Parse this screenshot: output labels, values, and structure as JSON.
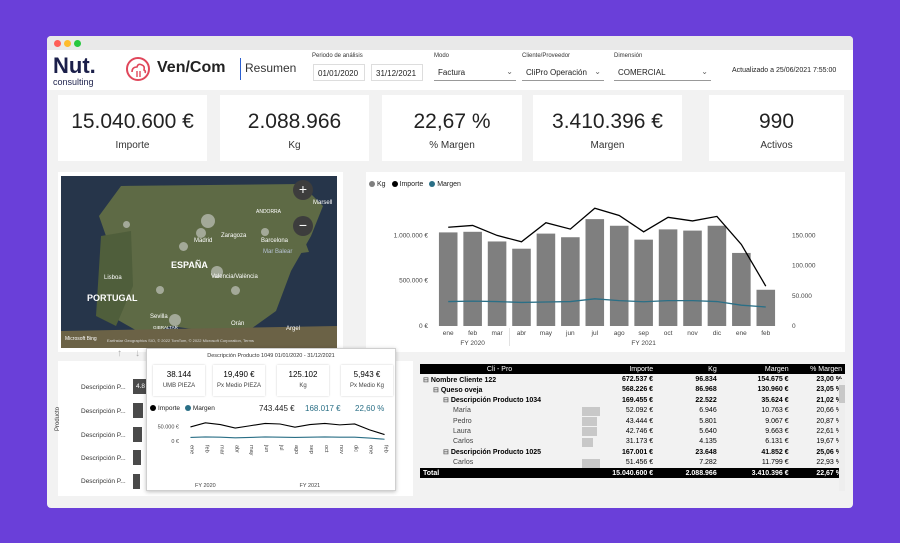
{
  "header": {
    "brand": "Nut.",
    "brand_sub": "consulting",
    "app_title": "Ven/Com",
    "page_title": "Resumen",
    "updated": "Actualizado a 25/06/2021 7:55:00"
  },
  "filters": {
    "periodo_label": "Periodo de análisis",
    "date_from": "01/01/2020",
    "date_to": "31/12/2021",
    "modo_label": "Modo",
    "modo_value": "Factura",
    "cliente_label": "Cliente/Proveedor",
    "cliente_value": "CliPro Operación",
    "dimension_label": "Dimensión",
    "dimension_value": "COMERCIAL"
  },
  "kpis": [
    {
      "value": "15.040.600 €",
      "label": "Importe"
    },
    {
      "value": "2.088.966",
      "label": "Kg"
    },
    {
      "value": "22,67 %",
      "label": "% Margen"
    },
    {
      "value": "3.410.396 €",
      "label": "Margen"
    },
    {
      "value": "990",
      "label": "Activos"
    }
  ],
  "map": {
    "labels": {
      "espana": "ESPAÑA",
      "portugal": "PORTUGAL",
      "madrid": "Madrid",
      "zaragoza": "Zaragoza",
      "barcelona": "Barcelona",
      "andorra": "ANDORRA",
      "marsella": "Marsell",
      "lisboa": "Lisboa",
      "valencia": "Valencia/València",
      "mar_balear": "Mar Balear",
      "sevilla": "Sevilla",
      "gibraltar": "GIBRALTAR",
      "oran": "Orán",
      "argel": "Argel",
      "bing": "Microsoft Bing",
      "attribution": "Earthstar Geographics SIO, © 2022 TomTom, © 2022 Microsoft Corporation, Terms",
      "zoom_in": "+",
      "zoom_out": "−"
    }
  },
  "chart_data": {
    "type": "bar",
    "legend": [
      "Kg",
      "Importe",
      "Margen"
    ],
    "categories": [
      "ene",
      "feb",
      "mar",
      "abr",
      "may",
      "jun",
      "jul",
      "ago",
      "sep",
      "oct",
      "nov",
      "dic",
      "ene",
      "feb"
    ],
    "year_groups": [
      {
        "label": "FY 2020",
        "span": [
          0,
          2
        ]
      },
      {
        "label": "FY 2021",
        "span": [
          3,
          13
        ]
      }
    ],
    "series": [
      {
        "name": "Kg",
        "axis": "right",
        "values": [
          155000,
          156000,
          140000,
          128000,
          153000,
          147000,
          177000,
          166000,
          143000,
          160000,
          158000,
          166000,
          121000,
          60000
        ]
      },
      {
        "name": "Importe",
        "axis": "left",
        "values": [
          1090000,
          1110000,
          1000000,
          930000,
          1140000,
          1070000,
          1300000,
          1220000,
          1040000,
          1200000,
          1160000,
          1210000,
          900000,
          440000
        ]
      },
      {
        "name": "Margen",
        "axis": "left",
        "values": [
          270000,
          275000,
          270000,
          260000,
          265000,
          270000,
          300000,
          280000,
          268000,
          280000,
          280000,
          270000,
          230000,
          210000
        ]
      }
    ],
    "left_ticks": [
      "1.000.000 €",
      "500.000 €",
      "0 €"
    ],
    "right_ticks": [
      "150.000",
      "100.000",
      "50.000",
      "0"
    ],
    "ylim_left": [
      0,
      1380000
    ],
    "ylim_right": [
      0,
      207000
    ],
    "colors": {
      "Kg": "#7f7f7f",
      "Importe": "#000000",
      "Margen": "#2a6f86"
    }
  },
  "product_chart": {
    "axis_label": "Producto",
    "rows": [
      "Descripción P...",
      "Descripción P...",
      "Descripción P...",
      "Descripción P...",
      "Descripción P..."
    ],
    "first_value": "4.8"
  },
  "tooltip": {
    "title": "Descripción Producto 1049 01/01/2020 - 31/12/2021",
    "cards": [
      {
        "value": "38.144",
        "label": "UMB PIEZA"
      },
      {
        "value": "19,490 €",
        "label": "Px Medio PIEZA"
      },
      {
        "value": "125.102",
        "label": "Kg"
      },
      {
        "value": "5,943 €",
        "label": "Px Medio Kg"
      }
    ],
    "legend_importe": "Importe",
    "legend_margen": "Margen",
    "importe_value": "743.445 €",
    "margen_value": "168.017 €",
    "pct_value": "22,60 %",
    "y_ticks": [
      "50.000 €",
      "0 €"
    ],
    "months": [
      "ene",
      "feb",
      "mar",
      "abr",
      "may",
      "jun",
      "jul",
      "ago",
      "sep",
      "oct",
      "nov",
      "dic",
      "ene",
      "feb"
    ],
    "fy2020": "FY 2020",
    "fy2021": "FY 2021",
    "series_importe": [
      48000,
      62000,
      56000,
      44000,
      52000,
      60000,
      58000,
      47000,
      56000,
      60000,
      55000,
      58000,
      38000,
      22000
    ],
    "series_margen": [
      12000,
      14000,
      13000,
      11000,
      12000,
      14000,
      13000,
      12000,
      13000,
      14000,
      13000,
      13000,
      10000,
      6000
    ]
  },
  "table": {
    "headers": [
      "Cli - Pro",
      "Importe",
      "Kg",
      "Margen",
      "% Margen"
    ],
    "rows": [
      {
        "indent": 0,
        "sign": "⊟",
        "name": "Nombre Cliente 122",
        "importe": "672.537 €",
        "kg": "96.834",
        "margen": "154.675 €",
        "pct": "23,00 %",
        "bold": true
      },
      {
        "indent": 1,
        "sign": "⊟",
        "name": "Queso oveja",
        "importe": "568.226 €",
        "kg": "86.968",
        "margen": "130.960 €",
        "pct": "23,05 %",
        "bold": true
      },
      {
        "indent": 2,
        "sign": "⊟",
        "name": "Descripción Producto 1034",
        "importe": "169.455 €",
        "kg": "22.522",
        "margen": "35.624 €",
        "pct": "21,02 %",
        "bold": true
      },
      {
        "indent": 3,
        "sign": "",
        "name": "María",
        "importe": "52.092 €",
        "kg": "6.946",
        "margen": "10.763 €",
        "pct": "20,66 %",
        "bold": false,
        "bar": 0.6
      },
      {
        "indent": 3,
        "sign": "",
        "name": "Pedro",
        "importe": "43.444 €",
        "kg": "5.801",
        "margen": "9.067 €",
        "pct": "20,87 %",
        "bold": false,
        "bar": 0.5
      },
      {
        "indent": 3,
        "sign": "",
        "name": "Laura",
        "importe": "42.746 €",
        "kg": "5.640",
        "margen": "9.663 €",
        "pct": "22,61 %",
        "bold": false,
        "bar": 0.5
      },
      {
        "indent": 3,
        "sign": "",
        "name": "Carlos",
        "importe": "31.173 €",
        "kg": "4.135",
        "margen": "6.131 €",
        "pct": "19,67 %",
        "bold": false,
        "bar": 0.36
      },
      {
        "indent": 2,
        "sign": "⊟",
        "name": "Descripción Producto 1025",
        "importe": "167.001 €",
        "kg": "23.648",
        "margen": "41.852 €",
        "pct": "25,06 %",
        "bold": true
      },
      {
        "indent": 3,
        "sign": "",
        "name": "Carlos",
        "importe": "51.456 €",
        "kg": "7.282",
        "margen": "11.799 €",
        "pct": "22,93 %",
        "bold": false,
        "bar": 0.6
      }
    ],
    "total": {
      "name": "Total",
      "importe": "15.040.600 €",
      "kg": "2.088.966",
      "margen": "3.410.396 €",
      "pct": "22,67 %"
    }
  },
  "colors": {
    "accent": "#2e6fd8",
    "background": "#6a3fd9",
    "margen": "#2a6f86"
  }
}
